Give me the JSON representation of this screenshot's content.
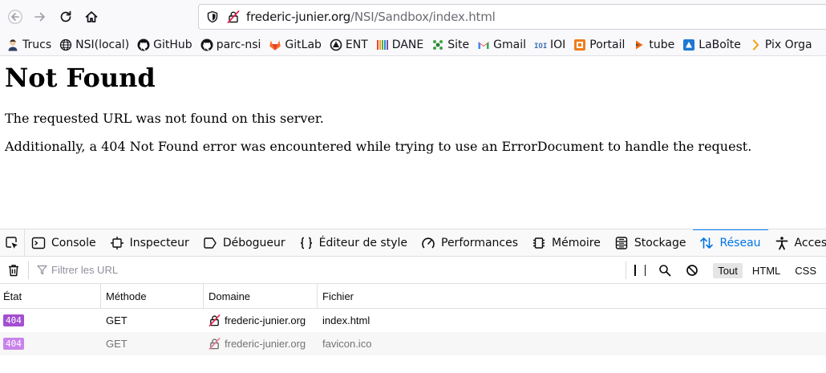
{
  "toolbar": {
    "url_host": "frederic-junier.org",
    "url_path": "/NSI/Sandbox/index.html"
  },
  "bookmarks": [
    {
      "label": "Trucs",
      "icon": "avatar-icon"
    },
    {
      "label": "NSI(local)",
      "icon": "globe-icon"
    },
    {
      "label": "GitHub",
      "icon": "github-icon"
    },
    {
      "label": "parc-nsi",
      "icon": "github-icon"
    },
    {
      "label": "GitLab",
      "icon": "gitlab-icon"
    },
    {
      "label": "ENT",
      "icon": "ent-icon"
    },
    {
      "label": "DANE",
      "icon": "dane-icon"
    },
    {
      "label": "Site",
      "icon": "site-icon"
    },
    {
      "label": "Gmail",
      "icon": "gmail-icon"
    },
    {
      "label": "IOI",
      "icon": "ioi-icon"
    },
    {
      "label": "Portail",
      "icon": "portail-icon"
    },
    {
      "label": "tube",
      "icon": "tube-icon"
    },
    {
      "label": "LaBoîte",
      "icon": "laboite-icon"
    },
    {
      "label": "Pix Orga",
      "icon": "pix-icon"
    }
  ],
  "page": {
    "title": "Not Found",
    "line1": "The requested URL was not found on this server.",
    "line2": "Additionally, a 404 Not Found error was encountered while trying to use an ErrorDocument to handle the request."
  },
  "devtools": {
    "tabs": [
      {
        "label": "Console",
        "icon": "console-icon"
      },
      {
        "label": "Inspecteur",
        "icon": "inspector-icon"
      },
      {
        "label": "Débogueur",
        "icon": "debugger-icon"
      },
      {
        "label": "Éditeur de style",
        "icon": "style-editor-icon"
      },
      {
        "label": "Performances",
        "icon": "performance-icon"
      },
      {
        "label": "Mémoire",
        "icon": "memory-icon"
      },
      {
        "label": "Stockage",
        "icon": "storage-icon"
      },
      {
        "label": "Réseau",
        "icon": "network-icon",
        "active": true
      },
      {
        "label": "Accessibilité",
        "icon": "accessibility-icon"
      }
    ],
    "filter_placeholder": "Filtrer les URL",
    "type_filters": [
      "Tout",
      "HTML",
      "CSS"
    ],
    "columns": [
      "État",
      "Méthode",
      "Domaine",
      "Fichier"
    ],
    "rows": [
      {
        "status": "404",
        "method": "GET",
        "domain": "frederic-junier.org",
        "file": "index.html"
      },
      {
        "status": "404",
        "method": "GET",
        "domain": "frederic-junier.org",
        "file": "favicon.ico"
      }
    ]
  },
  "colors": {
    "status_404": "#a24fd0",
    "active_tab": "#0074e8"
  }
}
